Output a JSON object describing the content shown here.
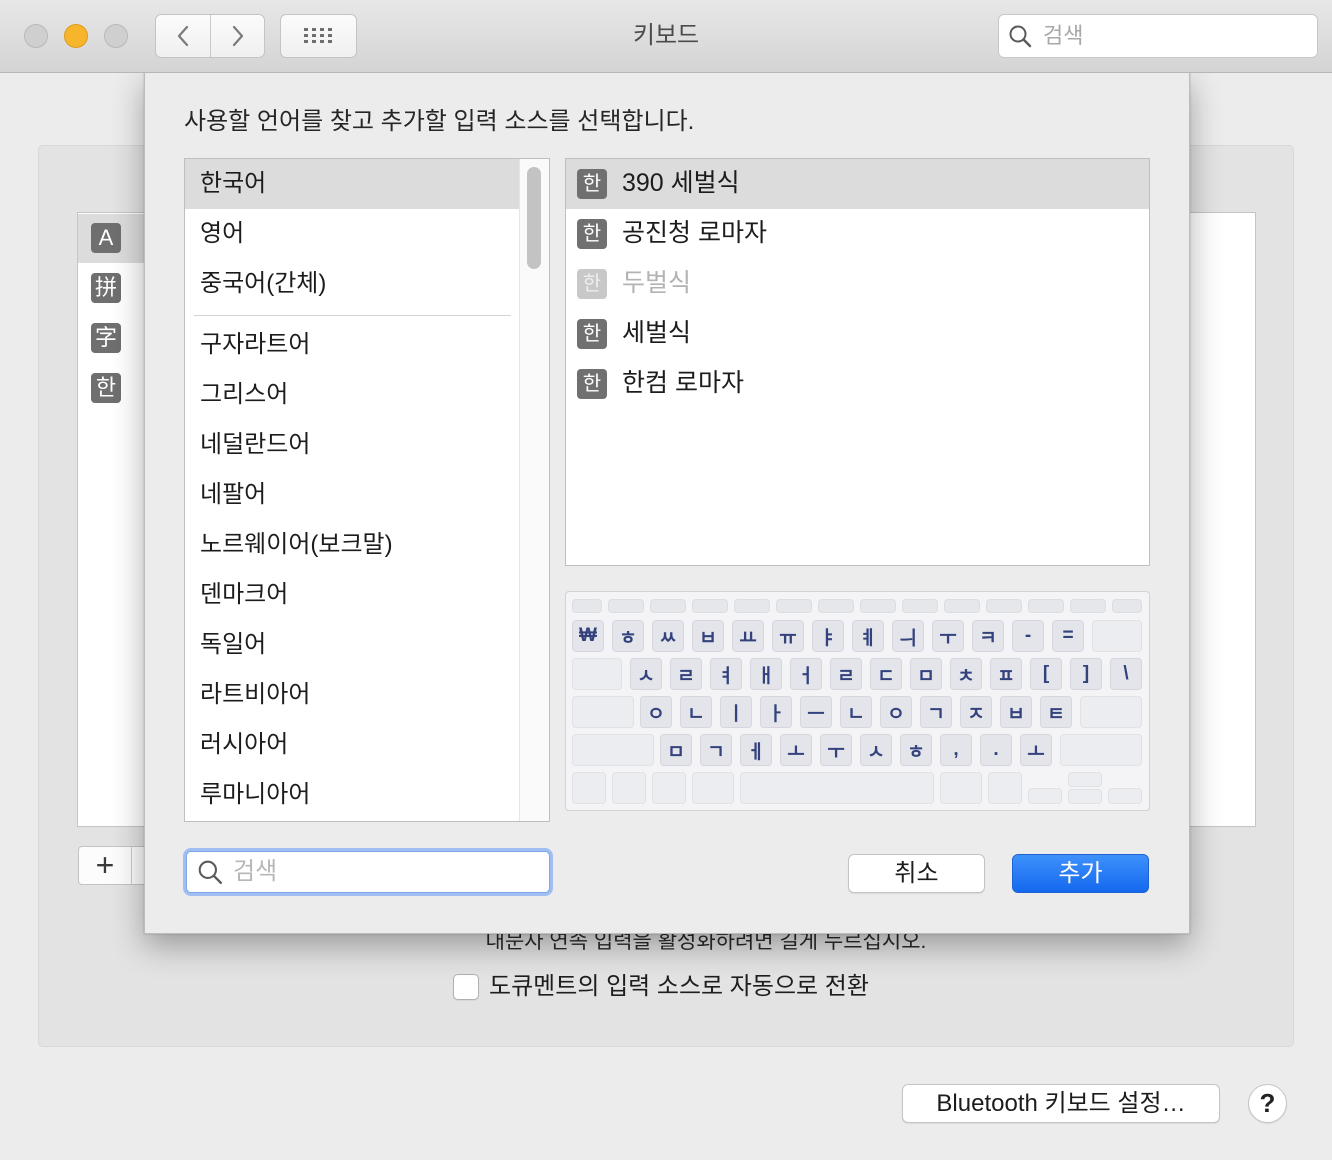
{
  "window": {
    "title": "키보드"
  },
  "toolbar": {
    "search_placeholder": "검색",
    "icons": [
      "chevron-left-icon",
      "chevron-right-icon",
      "grid-icon",
      "search-icon"
    ]
  },
  "background": {
    "input_sources": [
      {
        "badge": "A"
      },
      {
        "badge": "拼"
      },
      {
        "badge": "字"
      },
      {
        "badge": "한"
      }
    ],
    "selected_source_index": 0,
    "add_button": "+",
    "caps_hint": "대문자 연속 입력을 활성화하려면 길게 누르십시오.",
    "auto_switch": {
      "label": "도큐멘트의 입력 소스로 자동으로 전환",
      "checked": false
    },
    "bluetooth_button": "Bluetooth 키보드 설정…",
    "help_button": "?"
  },
  "sheet": {
    "instruction": "사용할 언어를 찾고 추가할 입력 소스를 선택합니다.",
    "languages": {
      "preferred": [
        "한국어",
        "영어",
        "중국어(간체)"
      ],
      "others": [
        "구자라트어",
        "그리스어",
        "네덜란드어",
        "네팔어",
        "노르웨이어(보크말)",
        "덴마크어",
        "독일어",
        "라트비아어",
        "러시아어",
        "루마니아어"
      ],
      "selected_index": 0
    },
    "input_sources": [
      {
        "badge": "한",
        "label": "390 세벌식",
        "selected": true,
        "enabled": true
      },
      {
        "badge": "한",
        "label": "공진청 로마자",
        "selected": false,
        "enabled": true
      },
      {
        "badge": "한",
        "label": "두벌식",
        "selected": false,
        "enabled": false
      },
      {
        "badge": "한",
        "label": "세벌식",
        "selected": false,
        "enabled": true
      },
      {
        "badge": "한",
        "label": "한컴 로마자",
        "selected": false,
        "enabled": true
      }
    ],
    "keyboard_preview": {
      "rows": [
        [
          "",
          "",
          "",
          "",
          "",
          "",
          "",
          "",
          "",
          "",
          "",
          "",
          "",
          ""
        ],
        [
          "₩",
          "ㅎ",
          "ㅆ",
          "ㅂ",
          "ㅛ",
          "ㅠ",
          "ㅑ",
          "ㅖ",
          "ㅢ",
          "ㅜ",
          "ㅋ",
          "-",
          "=",
          ""
        ],
        [
          "",
          "ㅅ",
          "ㄹ",
          "ㅕ",
          "ㅐ",
          "ㅓ",
          "ㄹ",
          "ㄷ",
          "ㅁ",
          "ㅊ",
          "ㅍ",
          "[",
          "]",
          "\\"
        ],
        [
          "",
          "ㅇ",
          "ㄴ",
          "ㅣ",
          "ㅏ",
          "ㅡ",
          "ㄴ",
          "ㅇ",
          "ㄱ",
          "ㅈ",
          "ㅂ",
          "ㅌ",
          ""
        ],
        [
          "",
          "ㅁ",
          "ㄱ",
          "ㅔ",
          "ㅗ",
          "ㅜ",
          "ㅅ",
          "ㅎ",
          ",",
          ".",
          "ㅗ",
          ""
        ],
        [
          "",
          "",
          "",
          "",
          "",
          "",
          "",
          "",
          "",
          "",
          ""
        ]
      ]
    },
    "search_placeholder": "검색",
    "cancel_button": "취소",
    "add_button": "추가"
  },
  "colors": {
    "accent_blue": "#1468ee",
    "minimize_yellow": "#f6b52a",
    "selection_gray": "#dcdcdc",
    "key_text": "#33427c",
    "focus_ring": "#9fbff3"
  }
}
